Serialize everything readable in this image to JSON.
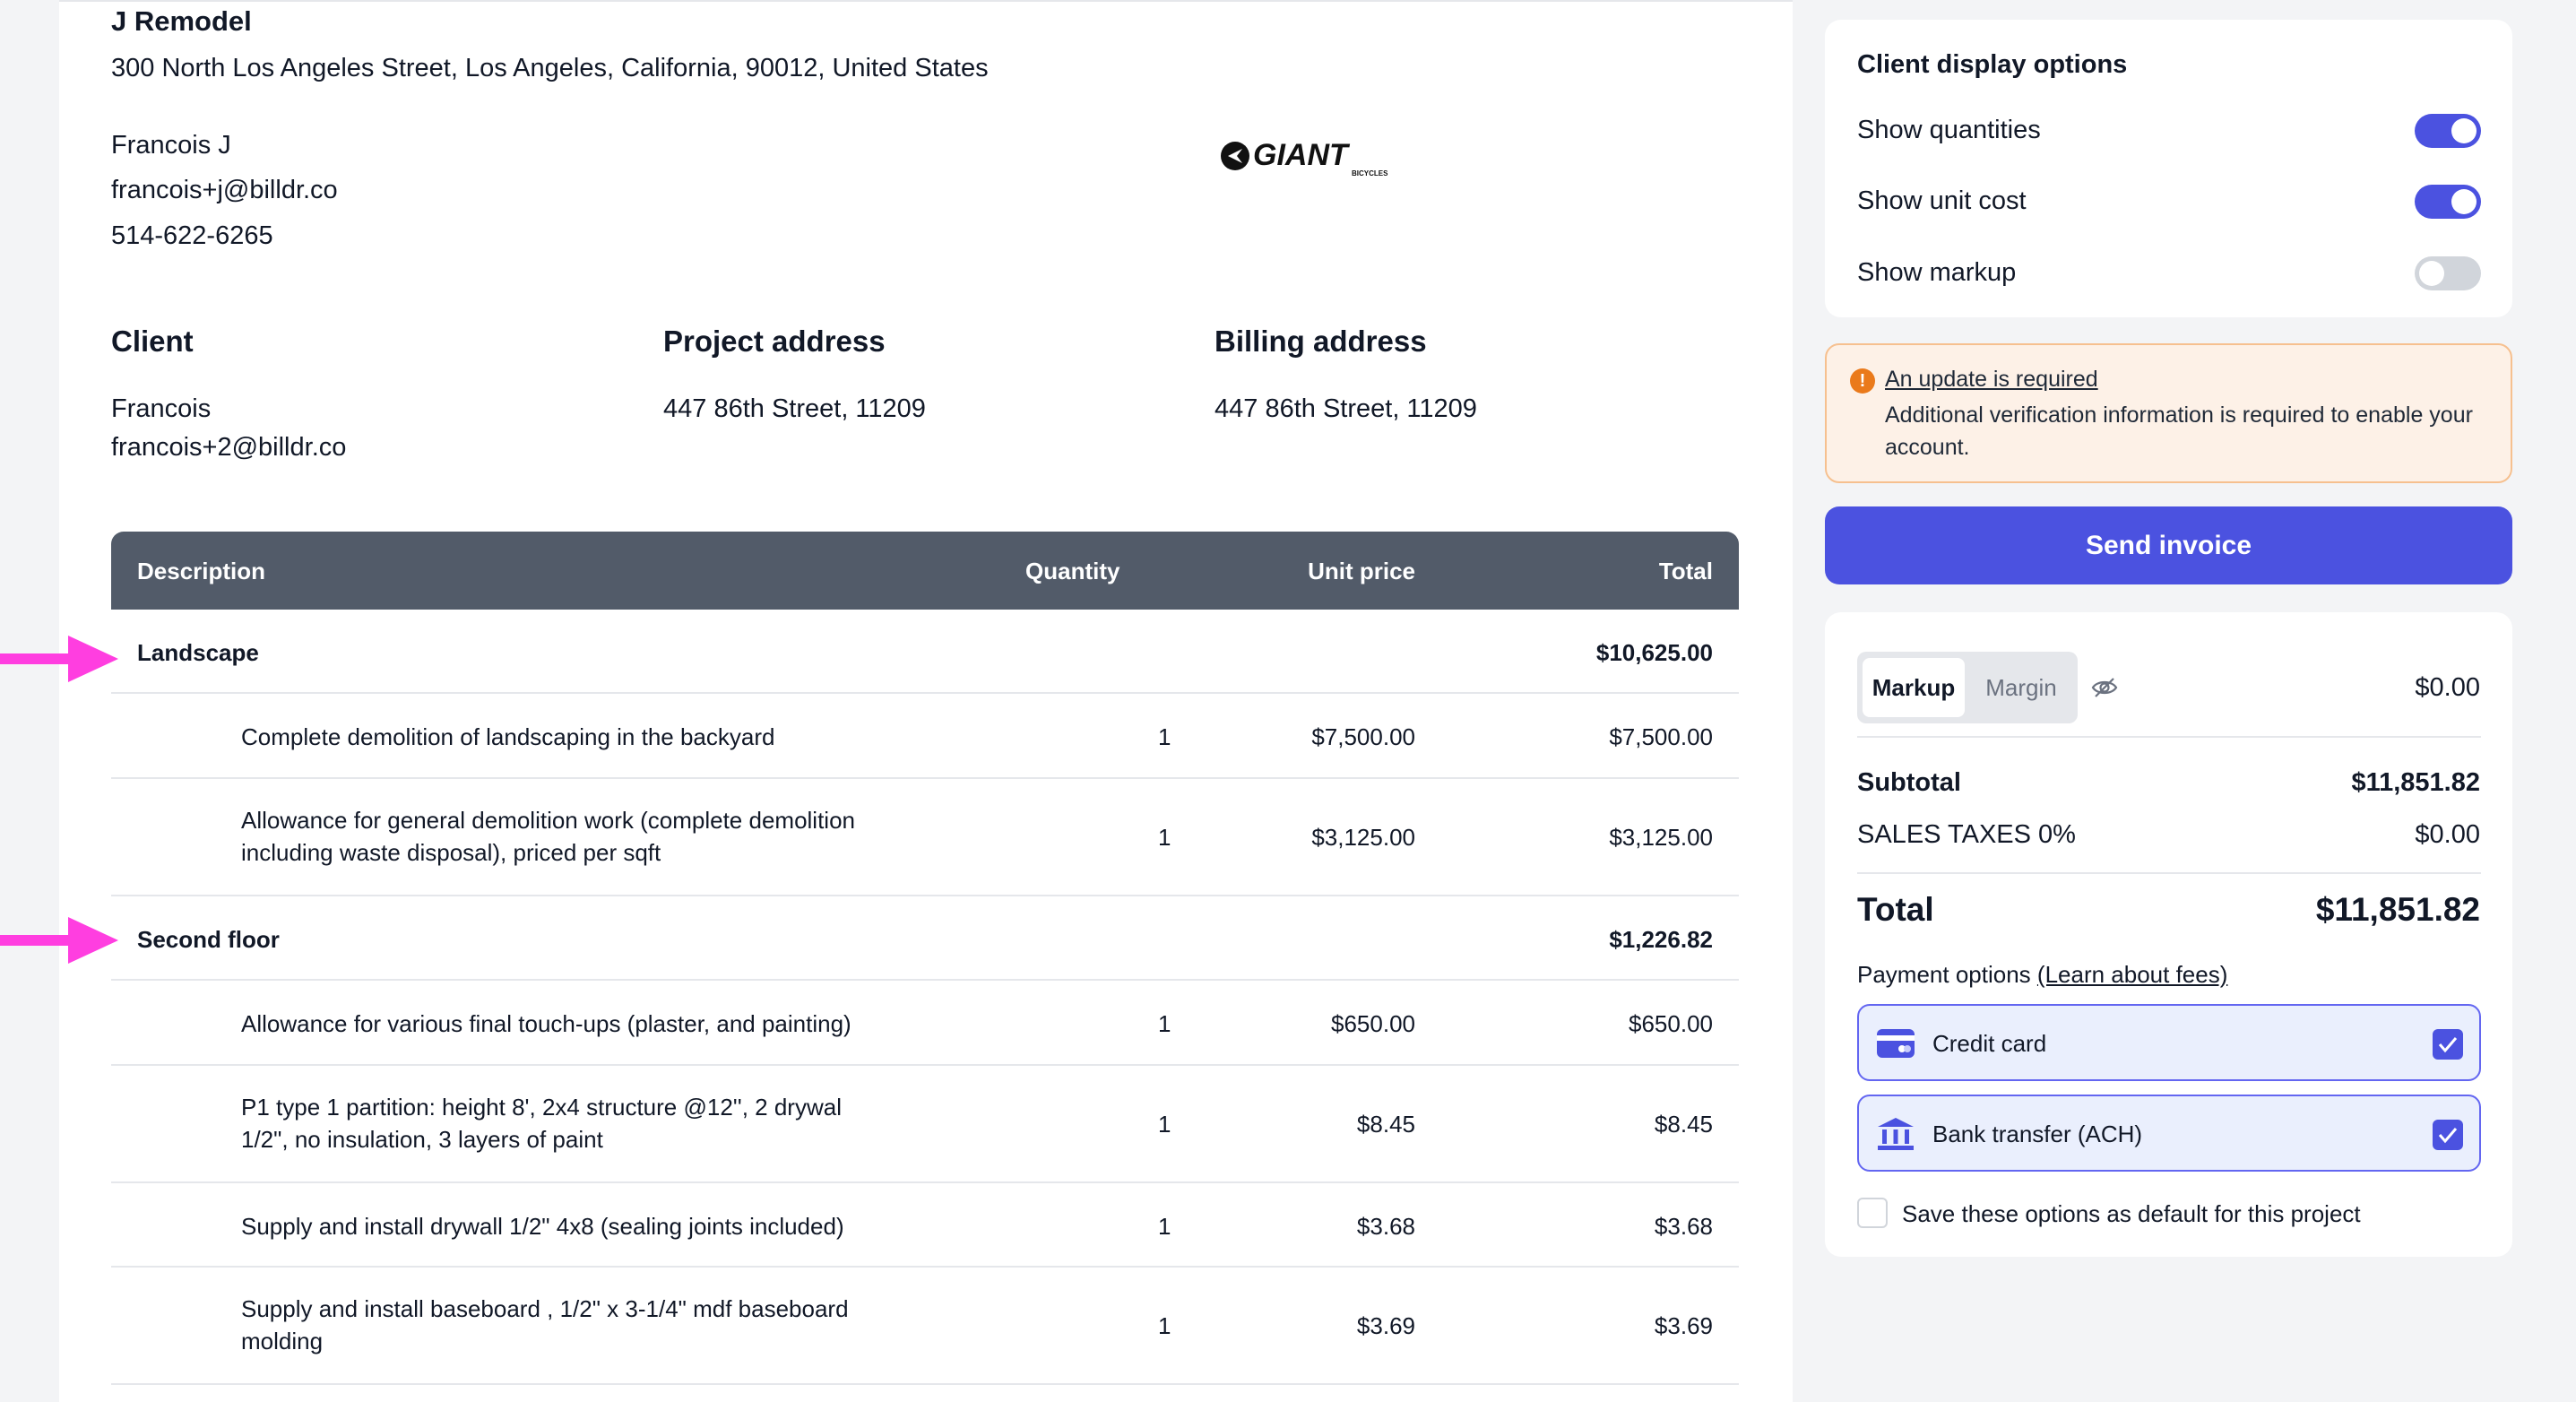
{
  "company": {
    "name": "J Remodel",
    "address": "300 North Los Angeles Street, Los Angeles, California, 90012, United States",
    "contact_name": "Francois J",
    "email": "francois+j@billdr.co",
    "phone": "514-622-6265",
    "logo_text": "GIANT",
    "logo_subtext": "BICYCLES"
  },
  "sections": {
    "client_title": "Client",
    "client_name": "Francois",
    "client_email": "francois+2@billdr.co",
    "project_title": "Project address",
    "project_value": "447 86th Street, 11209",
    "billing_title": "Billing address",
    "billing_value": "447 86th Street, 11209"
  },
  "table": {
    "headers": {
      "description": "Description",
      "quantity": "Quantity",
      "unit_price": "Unit price",
      "total": "Total"
    },
    "rows": [
      {
        "type": "group",
        "description": "Landscape",
        "total": "$10,625.00"
      },
      {
        "type": "item",
        "description": "Complete demolition of landscaping in the backyard",
        "quantity": "1",
        "unit_price": "$7,500.00",
        "total": "$7,500.00"
      },
      {
        "type": "item",
        "description_l1": "Allowance for general demolition work (complete demolition",
        "description_l2": "including waste disposal), priced per sqft",
        "quantity": "1",
        "unit_price": "$3,125.00",
        "total": "$3,125.00"
      },
      {
        "type": "group",
        "description": "Second floor",
        "total": "$1,226.82"
      },
      {
        "type": "item",
        "description": "Allowance for various final touch-ups (plaster, and painting)",
        "quantity": "1",
        "unit_price": "$650.00",
        "total": "$650.00"
      },
      {
        "type": "item",
        "description_l1": "P1 type 1 partition: height 8', 2x4 structure @12'', 2 drywal",
        "description_l2": "1/2\", no insulation, 3 layers of paint",
        "quantity": "1",
        "unit_price": "$8.45",
        "total": "$8.45"
      },
      {
        "type": "item",
        "description": "Supply and install drywall 1/2\" 4x8 (sealing joints included)",
        "quantity": "1",
        "unit_price": "$3.68",
        "total": "$3.68"
      },
      {
        "type": "item",
        "description_l1": "Supply and install baseboard , 1/2\" x 3-1/4\" mdf baseboard",
        "description_l2": "molding",
        "quantity": "1",
        "unit_price": "$3.69",
        "total": "$3.69"
      }
    ]
  },
  "display_options": {
    "title": "Client display options",
    "show_quantities": {
      "label": "Show quantities",
      "on": true
    },
    "show_unit_cost": {
      "label": "Show unit cost",
      "on": true
    },
    "show_markup": {
      "label": "Show markup",
      "on": false
    }
  },
  "alert": {
    "link": "An update is required",
    "text": "Additional verification information is required to enable your account.",
    "icon": "exclamation-icon"
  },
  "send_button": "Send invoice",
  "summary": {
    "markup_tab": "Markup",
    "margin_tab": "Margin",
    "markup_value": "$0.00",
    "subtotal_label": "Subtotal",
    "subtotal_value": "$11,851.82",
    "tax_label": "SALES TAXES 0%",
    "tax_value": "$0.00",
    "total_label": "Total",
    "total_value": "$11,851.82",
    "payment_label": "Payment options",
    "payment_link": "(Learn about fees)",
    "credit_card": "Credit card",
    "bank_transfer": "Bank transfer (ACH)",
    "save_default": "Save these options as default for this project"
  },
  "colors": {
    "accent": "#4b52e0",
    "table_header": "#525b69",
    "arrow": "#ff3ee0",
    "alert_bg": "#fdf1e7",
    "alert_icon": "#ea7a1b"
  }
}
